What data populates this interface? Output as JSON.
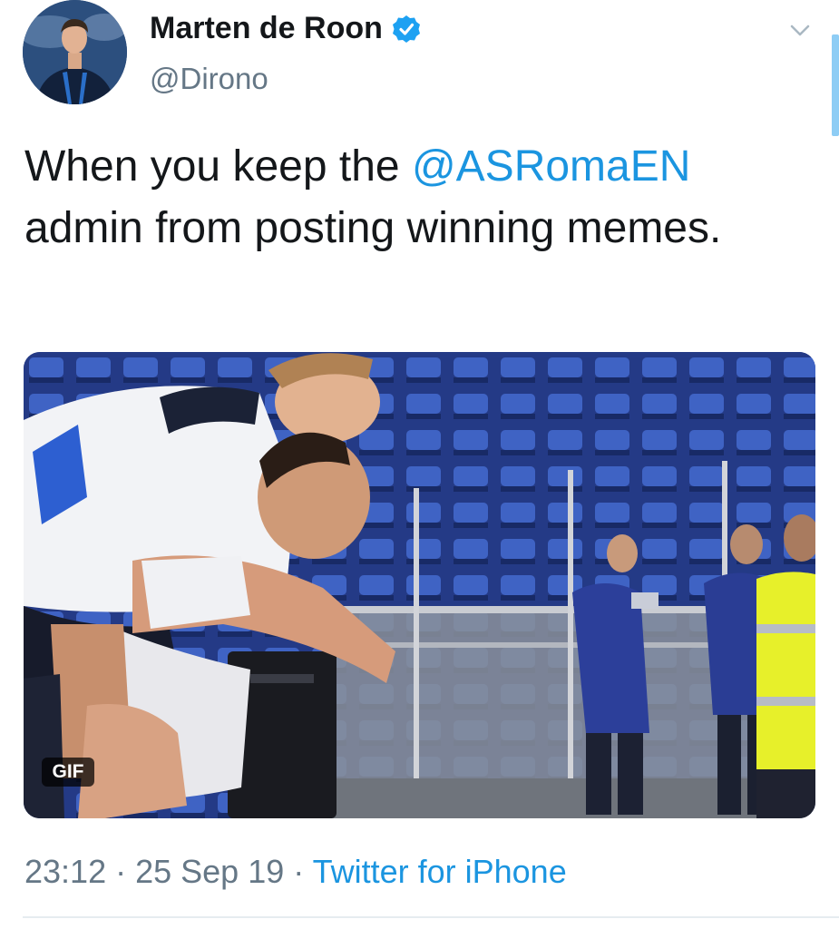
{
  "author": {
    "display_name": "Marten de Roon",
    "handle": "@Dirono",
    "verified": true,
    "avatar_icon": "profile-photo"
  },
  "tweet": {
    "text_parts": {
      "before": "When you keep the ",
      "mention": "@ASRomaEN",
      "after": " admin from posting winning memes."
    },
    "media": {
      "type": "gif",
      "badge": "GIF"
    },
    "time": "23:12",
    "date": "25 Sep 19",
    "source": "Twitter for iPhone",
    "separator": " · "
  },
  "colors": {
    "link": "#1b95e0",
    "secondary_text": "#657786",
    "verified_badge": "#1da1f2"
  },
  "icons": {
    "menu": "chevron-down-icon",
    "verified": "verified-badge-icon"
  }
}
